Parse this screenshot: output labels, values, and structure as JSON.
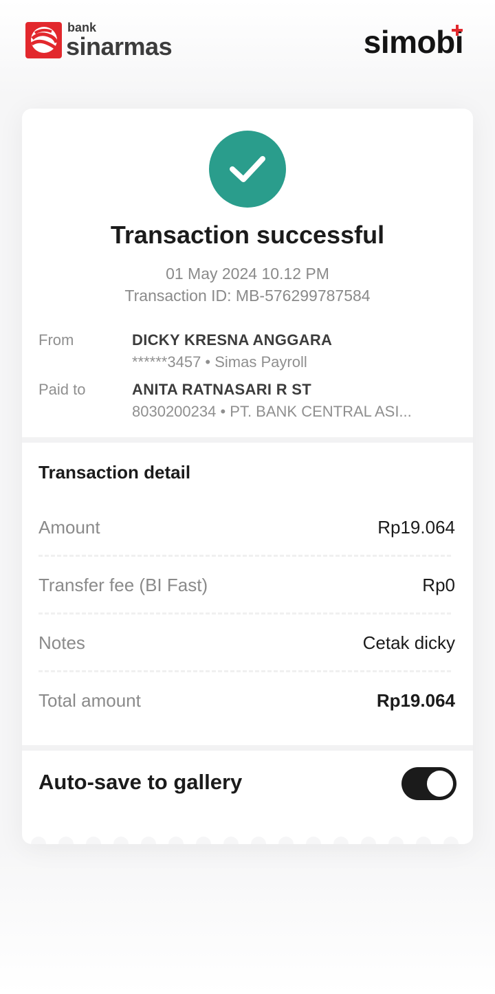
{
  "header": {
    "bank_small": "bank",
    "bank_big": "sinarmas",
    "app_logo": "simobi"
  },
  "colors": {
    "bank_red": "#e2282d",
    "success_green": "#2a9d8c",
    "toggle_on": "#1b1b1b"
  },
  "receipt": {
    "icon": "check-icon",
    "title": "Transaction successful",
    "datetime": "01 May 2024 10.12 PM",
    "transaction_id": "Transaction ID: MB-576299787584",
    "from": {
      "label": "From",
      "name": "DICKY KRESNA ANGGARA",
      "detail": "******3457 • Simas Payroll"
    },
    "paid_to": {
      "label": "Paid to",
      "name": "ANITA RATNASARI R ST",
      "detail": "8030200234 • PT. BANK CENTRAL ASI..."
    }
  },
  "detail": {
    "title": "Transaction detail",
    "rows": [
      {
        "label": "Amount",
        "value": "Rp19.064"
      },
      {
        "label": "Transfer fee (BI Fast)",
        "value": "Rp0"
      },
      {
        "label": "Notes",
        "value": "Cetak dicky"
      },
      {
        "label": "Total amount",
        "value": "Rp19.064"
      }
    ]
  },
  "autosave": {
    "label": "Auto-save to gallery",
    "enabled": true
  }
}
